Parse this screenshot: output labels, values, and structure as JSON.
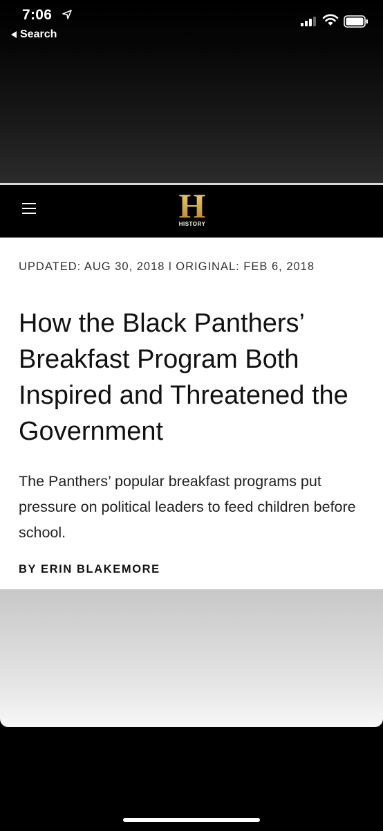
{
  "status_bar": {
    "time": "7:06",
    "back_label": "Search"
  },
  "site": {
    "logo_letter": "H",
    "logo_word": "HISTORY"
  },
  "article": {
    "dateline": "UPDATED: AUG 30, 2018 l ORIGINAL: FEB 6, 2018",
    "headline": "How the Black Panthers’ Breakfast Program Both Inspired and Threatened the Government",
    "dek": "The Panthers’ popular breakfast programs put pressure on political leaders to feed children before school.",
    "byline": "BY ERIN BLAKEMORE"
  },
  "icons": {
    "location": "location-arrow-icon",
    "back": "back-arrow-icon",
    "signal": "cellular-signal-icon",
    "wifi": "wifi-icon",
    "battery": "battery-icon",
    "menu": "hamburger-menu-icon"
  },
  "colors": {
    "logo_gold": "#d6a53a",
    "header_bg": "#000000"
  }
}
